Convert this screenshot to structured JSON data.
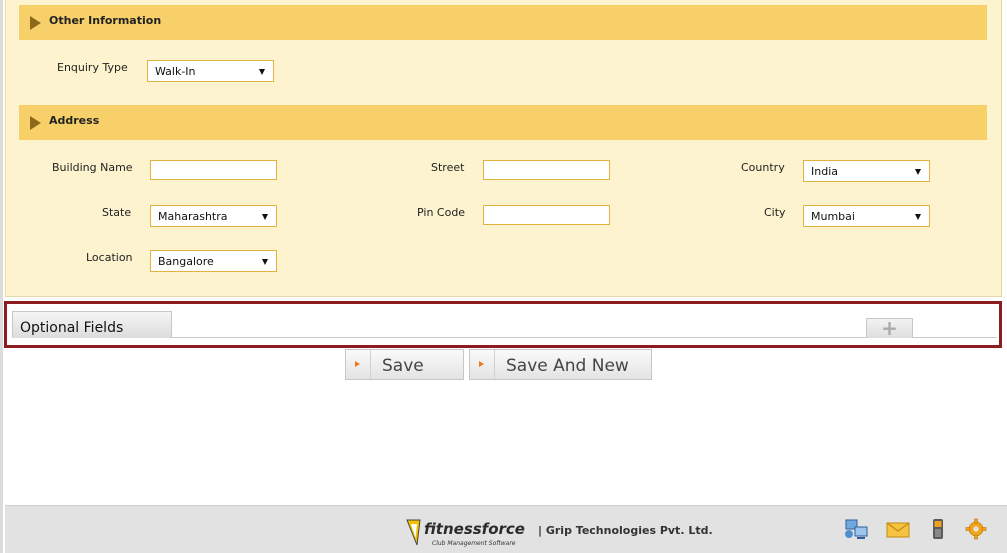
{
  "sections": {
    "other_info": {
      "title": "Other Information",
      "enquiry_type_label": "Enquiry Type",
      "enquiry_type_value": "Walk-In"
    },
    "address": {
      "title": "Address",
      "building_name_label": "Building Name",
      "building_name_value": "",
      "street_label": "Street",
      "street_value": "",
      "country_label": "Country",
      "country_value": "India",
      "state_label": "State",
      "state_value": "Maharashtra",
      "pin_code_label": "Pin Code",
      "pin_code_value": "",
      "city_label": "City",
      "city_value": "Mumbai",
      "location_label": "Location",
      "location_value": "Bangalore"
    }
  },
  "optional": {
    "tab_label": "Optional Fields",
    "add_label": "+"
  },
  "actions": {
    "save_label": "Save",
    "save_new_label": "Save And New"
  },
  "footer": {
    "company": "| Grip Technologies Pvt. Ltd.",
    "logo_text": "fitnessforce",
    "logo_tagline": "Club Management Software",
    "icons": [
      "computer-network-icon",
      "mail-icon",
      "phone-icon",
      "gear-icon"
    ]
  },
  "colors": {
    "section_header": "#f8d06a",
    "form_background": "#fdf3cf",
    "input_border": "#e2b23e",
    "highlight_border": "#8c1c20",
    "button_arrow": "#ef7a1a"
  }
}
